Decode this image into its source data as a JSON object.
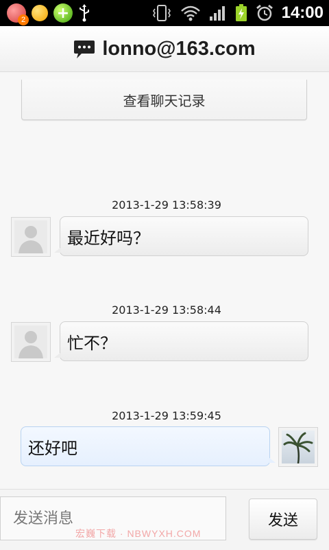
{
  "status_bar": {
    "time": "14:00",
    "notification_badge": "2",
    "icons": [
      "app-icon",
      "orange-ball-icon",
      "plus-icon",
      "usb-icon",
      "vibrate-icon",
      "wifi-icon",
      "signal-icon",
      "battery-charging-icon",
      "alarm-icon"
    ]
  },
  "header": {
    "title": "lonno@163.com",
    "icon": "chat-bubble-icon"
  },
  "history_button": {
    "label": "查看聊天记录"
  },
  "messages": [
    {
      "timestamp": "2013-1-29 13:58:39",
      "text": "最近好吗？",
      "direction": "incoming",
      "avatar": "default-avatar-icon"
    },
    {
      "timestamp": "2013-1-29 13:58:44",
      "text": "忙不？",
      "direction": "incoming",
      "avatar": "default-avatar-icon"
    },
    {
      "timestamp": "2013-1-29 13:59:45",
      "text": "还好吧",
      "direction": "outgoing",
      "avatar": "palm-tree-avatar"
    }
  ],
  "composer": {
    "placeholder": "发送消息",
    "value": "",
    "send_label": "发送",
    "watermark": "宏巍下载 · NBWYXH.COM"
  },
  "colors": {
    "status_bar_bg": "#000000",
    "incoming_bubble": "#ececec",
    "outgoing_bubble": "#e6f0fe",
    "outgoing_border": "#b8d3f1"
  }
}
